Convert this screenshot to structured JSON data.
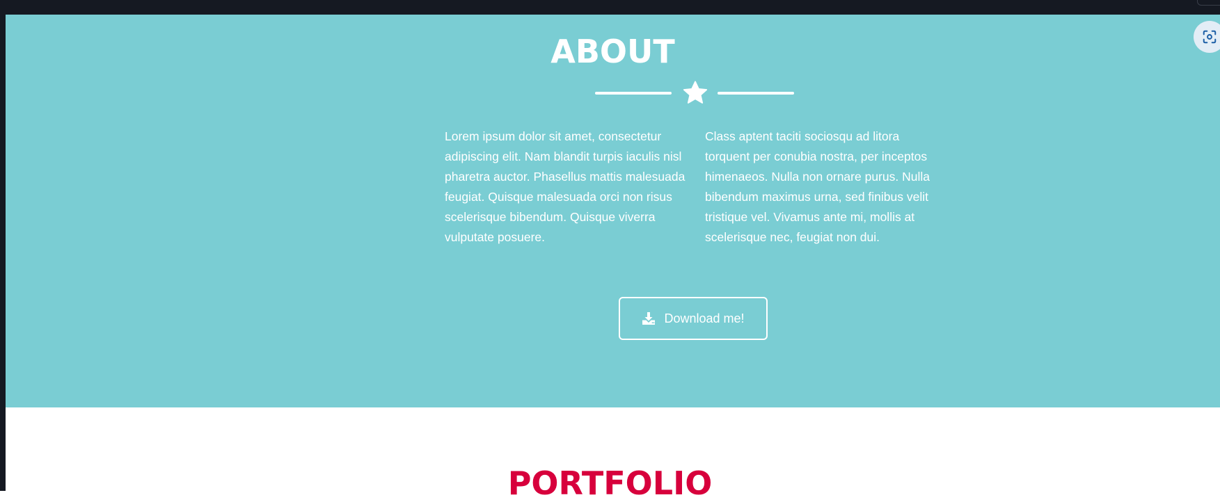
{
  "about": {
    "title": "ABOUT",
    "paragraph_left": "Lorem ipsum dolor sit amet, consectetur adipiscing elit. Nam blandit turpis iaculis nisl pharetra auctor. Phasellus mattis malesuada feugiat. Quisque malesuada orci non risus scelerisque bibendum. Quisque viverra vulputate posuere.",
    "paragraph_right": "Class aptent taciti sociosqu ad litora torquent per conubia nostra, per inceptos himenaeos. Nulla non ornare purus. Nulla bibendum maximus urna, sed finibus velit tristique vel. Vivamus ante mi, mollis at scelerisque nec, feugiat non dui.",
    "download_label": "Download me!",
    "divider_icon": "star-icon",
    "download_icon": "download-icon"
  },
  "portfolio": {
    "title": "PORTFOLIO"
  },
  "browser": {
    "lens_icon": "screenshot-lens-icon"
  },
  "colors": {
    "about_bg": "#7acdd3",
    "portfolio_title": "#d7003c",
    "chrome_dark": "#151922",
    "text_light": "#ffffff"
  }
}
